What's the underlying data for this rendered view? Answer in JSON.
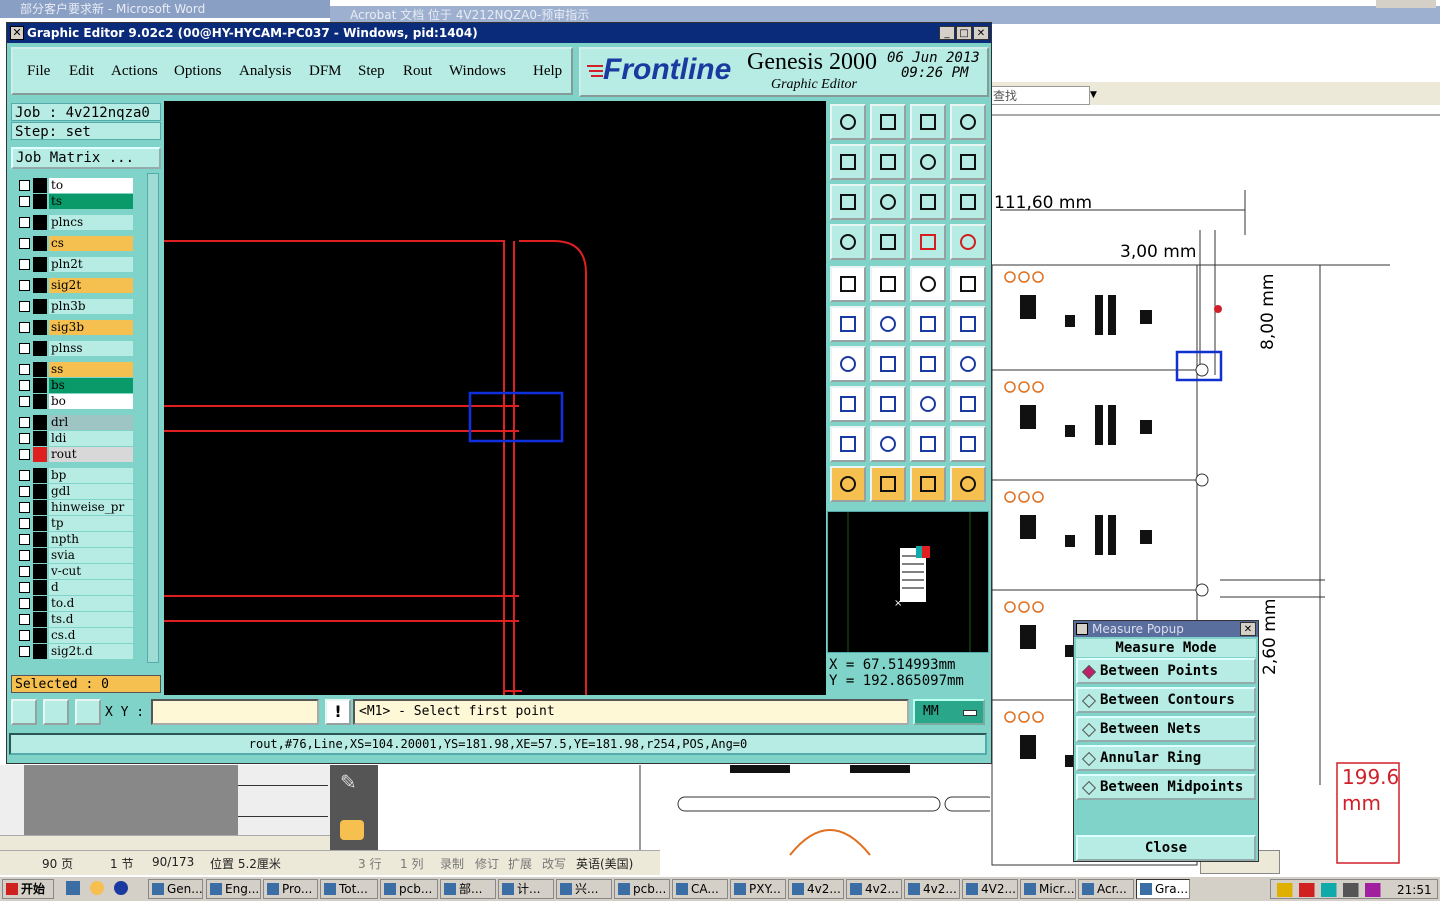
{
  "background": {
    "word_title": "部分客户要求新 - Microsoft Word",
    "acrobat_title": "Acrobat 文档 位于 4V212NQZA0-预审指示",
    "find_label": "查找",
    "word_status": {
      "page": "90 页",
      "section": "1 节",
      "page_of": "90/173",
      "position": "位置 5.2厘米",
      "line": "3 行",
      "col": "1 列",
      "rec": "录制",
      "trk": "修订",
      "ext": "扩展",
      "ovr": "改写",
      "lang": "英语(美国)"
    },
    "pdf": {
      "dim_111": "111,60 mm",
      "dim_3": "3,00 mm",
      "dim_8": "8,00 mm",
      "dim_26": "2,60 mm",
      "dim_199": "199.6",
      "dim_199_unit": "mm"
    }
  },
  "genesis": {
    "title": "Graphic Editor 9.02c2 (00@HY-HYCAM-PC037 - Windows, pid:1404)",
    "menu": [
      "File",
      "Edit",
      "Actions",
      "Options",
      "Analysis",
      "DFM",
      "Step",
      "Rout",
      "Windows",
      "Help"
    ],
    "brand": {
      "logo": "Frontline",
      "product": "Genesis 2000",
      "subtitle": "Graphic Editor",
      "date": "06 Jun 2013",
      "time": "09:26 PM"
    },
    "job": "Job : 4v212nqza0",
    "step": "Step: set",
    "job_matrix": "Job Matrix ...",
    "layers": [
      {
        "name": "to",
        "color": "#ffffff"
      },
      {
        "name": "ts",
        "color": "#0a9a6a"
      },
      {
        "name": "plncs",
        "color": "#b6ece3"
      },
      {
        "name": "cs",
        "color": "#f5c04f"
      },
      {
        "name": "pln2t",
        "color": "#b6ece3"
      },
      {
        "name": "sig2t",
        "color": "#f5c04f"
      },
      {
        "name": "pln3b",
        "color": "#b6ece3"
      },
      {
        "name": "sig3b",
        "color": "#f5c04f"
      },
      {
        "name": "plnss",
        "color": "#b6ece3"
      },
      {
        "name": "ss",
        "color": "#f5c04f"
      },
      {
        "name": "bs",
        "color": "#0a9a6a"
      },
      {
        "name": "bo",
        "color": "#ffffff"
      },
      {
        "name": "drl",
        "color": "#9ec4c4"
      },
      {
        "name": "ldi",
        "color": "#b6ece3"
      },
      {
        "name": "rout",
        "color": "#d8d8d8"
      },
      {
        "name": "bp",
        "color": "#b6ece3"
      },
      {
        "name": "gdl",
        "color": "#b6ece3"
      },
      {
        "name": "hinweise_pr",
        "color": "#b6ece3"
      },
      {
        "name": "tp",
        "color": "#b6ece3"
      },
      {
        "name": "npth",
        "color": "#b6ece3"
      },
      {
        "name": "svia",
        "color": "#b6ece3"
      },
      {
        "name": "v-cut",
        "color": "#b6ece3"
      },
      {
        "name": "d",
        "color": "#b6ece3"
      },
      {
        "name": "to.d",
        "color": "#b6ece3"
      },
      {
        "name": "ts.d",
        "color": "#b6ece3"
      },
      {
        "name": "cs.d",
        "color": "#b6ece3"
      },
      {
        "name": "sig2t.d",
        "color": "#b6ece3"
      }
    ],
    "selected": "Selected : 0",
    "coords": {
      "x": "X  =  67.514993mm",
      "y": "Y  =  192.865097mm"
    },
    "xy_label": "X Y :",
    "xy_value": "",
    "prompt": "<M1> - Select first point",
    "units": "MM",
    "status_line": "rout,#76,Line,XS=104.20001,YS=181.98,XE=57.5,YE=181.98,r254,POS,Ang=0"
  },
  "measure_popup": {
    "title": "Measure Popup",
    "mode_label": "Measure Mode",
    "options": [
      "Between Points",
      "Between Contours",
      "Between Nets",
      "Annular Ring",
      "Between Midpoints"
    ],
    "selected_index": 0,
    "close": "Close"
  },
  "taskbar": {
    "start": "开始",
    "tasks": [
      "Gen...",
      "Eng...",
      "Pro...",
      "Tot...",
      "pcb...",
      "部...",
      "计...",
      "兴...",
      "pcb...",
      "CA...",
      "PXY...",
      "4v2...",
      "4v2...",
      "4v2...",
      "4V2...",
      "Micr...",
      "Acr...",
      "Gra..."
    ],
    "clock": "21:51"
  }
}
